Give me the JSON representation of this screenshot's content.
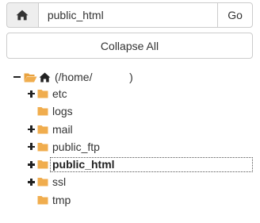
{
  "path_bar": {
    "home_icon": "home-icon",
    "path_value": "public_html",
    "go_label": "Go"
  },
  "collapse_all_label": "Collapse All",
  "tree": {
    "root_label": "(/home/            )",
    "root_icons": [
      "open-folder-icon",
      "home-icon"
    ],
    "folder_color": "#f0ad4e",
    "items": [
      {
        "label": "etc",
        "has_children": true,
        "selected": false
      },
      {
        "label": "logs",
        "has_children": false,
        "selected": false
      },
      {
        "label": "mail",
        "has_children": true,
        "selected": false
      },
      {
        "label": "public_ftp",
        "has_children": true,
        "selected": false
      },
      {
        "label": "public_html",
        "has_children": true,
        "selected": true
      },
      {
        "label": "ssl",
        "has_children": true,
        "selected": false
      },
      {
        "label": "tmp",
        "has_children": false,
        "selected": false
      }
    ]
  }
}
